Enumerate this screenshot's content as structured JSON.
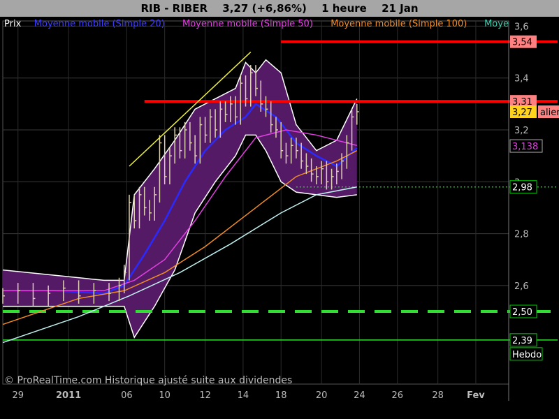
{
  "header": {
    "symbol": "RIB - RIBER",
    "price_change": "3,27 (+6,86%)",
    "timeframe": "1 heure",
    "date": "21 Jan"
  },
  "legend": [
    {
      "label": "Prix",
      "color": "#ffffff"
    },
    {
      "label": "Moyenne mobile (Simple 20)",
      "color": "#3c3cff"
    },
    {
      "label": "Moyenne mobile (Simple 50)",
      "color": "#e040e0"
    },
    {
      "label": "Moyenne mobile (Simple 100)",
      "color": "#f08c28"
    },
    {
      "label": "Moye",
      "color": "#40d0b0"
    }
  ],
  "footer": "© ProRealTime.com Historique ajusté suite aux dividendes",
  "price_tags": [
    {
      "text": "3,54",
      "value": 3.54,
      "bg": "#ff8080",
      "fg": "#000000"
    },
    {
      "text": "3,31",
      "value": 3.31,
      "bg": "#ff8080",
      "fg": "#000000"
    },
    {
      "text": "alier",
      "value": 3.27,
      "bg": "#ff8080",
      "fg": "#000000",
      "offset": "right"
    },
    {
      "text": "3,27",
      "value": 3.27,
      "bg": "#ffd21e",
      "fg": "#000000"
    },
    {
      "text": "3,138",
      "value": 3.138,
      "bg": "#000000",
      "fg": "#e040e0",
      "border": "#aaaaaa"
    },
    {
      "text": "2,98",
      "value": 2.98,
      "bg": "#000000",
      "fg": "#ffffff",
      "border": "#00cc00"
    },
    {
      "text": "2,50",
      "value": 2.5,
      "bg": "#000000",
      "fg": "#ffffff",
      "border": "#00cc00"
    },
    {
      "text": "2,39",
      "value": 2.39,
      "bg": "#000000",
      "fg": "#ffffff",
      "border": "#00cc00"
    },
    {
      "text": "Hebdo",
      "value": 2.36,
      "bg": "#000000",
      "fg": "#ffffff",
      "border": "#00cc00"
    }
  ],
  "chart_data": {
    "type": "line",
    "title": "RIB - RIBER 3,27 (+6,86%) 1 heure 21 Jan",
    "ylim": [
      2.22,
      3.62
    ],
    "y_ticks": [
      2.6,
      2.8,
      3.0,
      3.2,
      3.4,
      3.6
    ],
    "y_tick_labels": [
      "2,6",
      "2,8",
      "3",
      "3,2",
      "3,4",
      "3,6"
    ],
    "x_ticks": [
      "29",
      "2011",
      "06",
      "10",
      "12",
      "14",
      "18",
      "20",
      "24",
      "26",
      "28",
      "Fev"
    ],
    "x_tick_bold": [
      "2011",
      "Fev"
    ],
    "grid": true,
    "horizontal_lines": [
      {
        "value": 3.54,
        "color": "#ff0000",
        "style": "solid",
        "x_from": 0.55,
        "x_to": 1.0
      },
      {
        "value": 3.31,
        "color": "#ff0000",
        "style": "solid",
        "x_from": 0.28,
        "x_to": 1.0
      },
      {
        "value": 2.98,
        "color": "#30c030",
        "style": "dotted",
        "x_from": 0.58,
        "x_to": 1.0
      },
      {
        "value": 2.5,
        "color": "#30e030",
        "style": "dashed",
        "x_from": 0.0,
        "x_to": 1.0
      },
      {
        "value": 2.39,
        "color": "#30e030",
        "style": "solid",
        "x_from": 0.0,
        "x_to": 1.0
      }
    ],
    "trendline": {
      "color": "#f0f040",
      "points": [
        [
          0.25,
          3.06
        ],
        [
          0.49,
          3.5
        ]
      ]
    },
    "price_series": {
      "name": "Prix",
      "x": [
        0.0,
        0.03,
        0.06,
        0.09,
        0.12,
        0.15,
        0.18,
        0.21,
        0.23,
        0.24,
        0.25,
        0.26,
        0.27,
        0.28,
        0.29,
        0.3,
        0.31,
        0.32,
        0.33,
        0.34,
        0.35,
        0.36,
        0.37,
        0.38,
        0.39,
        0.4,
        0.41,
        0.42,
        0.43,
        0.44,
        0.45,
        0.46,
        0.47,
        0.48,
        0.49,
        0.5,
        0.51,
        0.52,
        0.53,
        0.54,
        0.55,
        0.56,
        0.57,
        0.58,
        0.59,
        0.6,
        0.61,
        0.62,
        0.63,
        0.64,
        0.65,
        0.66,
        0.67,
        0.68,
        0.69,
        0.7
      ],
      "values": [
        2.56,
        2.58,
        2.55,
        2.57,
        2.59,
        2.56,
        2.58,
        2.57,
        2.6,
        2.65,
        2.92,
        2.85,
        2.95,
        2.9,
        2.88,
        2.95,
        3.15,
        3.02,
        3.1,
        3.18,
        3.12,
        3.2,
        3.15,
        3.1,
        3.22,
        3.18,
        3.25,
        3.2,
        3.28,
        3.26,
        3.3,
        3.25,
        3.38,
        3.32,
        3.42,
        3.36,
        3.3,
        3.28,
        3.22,
        3.2,
        3.12,
        3.1,
        3.14,
        3.12,
        3.08,
        3.06,
        3.03,
        3.02,
        3.05,
        3.0,
        3.02,
        3.04,
        3.08,
        3.15,
        3.25,
        3.27
      ]
    },
    "series": [
      {
        "name": "Moyenne mobile (Simple 20)",
        "color": "#2a2aff",
        "x": [
          0.0,
          0.1,
          0.2,
          0.24,
          0.28,
          0.32,
          0.36,
          0.4,
          0.44,
          0.48,
          0.5,
          0.54,
          0.58,
          0.62,
          0.66,
          0.7
        ],
        "values": [
          2.58,
          2.58,
          2.57,
          2.6,
          2.72,
          2.85,
          3.0,
          3.12,
          3.2,
          3.25,
          3.3,
          3.25,
          3.15,
          3.1,
          3.06,
          3.13
        ]
      },
      {
        "name": "Moyenne mobile (Simple 50)",
        "color": "#e040e0",
        "x": [
          0.0,
          0.2,
          0.26,
          0.32,
          0.38,
          0.44,
          0.5,
          0.56,
          0.62,
          0.7
        ],
        "values": [
          2.58,
          2.58,
          2.62,
          2.7,
          2.85,
          3.02,
          3.17,
          3.2,
          3.18,
          3.14
        ]
      },
      {
        "name": "Moyenne mobile (Simple 100)",
        "color": "#f08c28",
        "x": [
          0.0,
          0.15,
          0.24,
          0.32,
          0.4,
          0.5,
          0.58,
          0.66,
          0.7
        ],
        "values": [
          2.45,
          2.55,
          2.58,
          2.65,
          2.75,
          2.9,
          3.02,
          3.08,
          3.12
        ]
      },
      {
        "name": "Moye",
        "color": "#c0f0f0",
        "x": [
          0.0,
          0.15,
          0.25,
          0.35,
          0.45,
          0.55,
          0.62,
          0.7
        ],
        "values": [
          2.38,
          2.48,
          2.56,
          2.65,
          2.76,
          2.88,
          2.95,
          2.98
        ]
      }
    ],
    "bollinger": {
      "x": [
        0.0,
        0.1,
        0.2,
        0.24,
        0.26,
        0.3,
        0.34,
        0.38,
        0.42,
        0.46,
        0.48,
        0.5,
        0.52,
        0.55,
        0.58,
        0.62,
        0.66,
        0.7
      ],
      "upper": [
        2.66,
        2.64,
        2.62,
        2.62,
        2.95,
        3.05,
        3.16,
        3.28,
        3.32,
        3.36,
        3.46,
        3.42,
        3.47,
        3.42,
        3.22,
        3.12,
        3.16,
        3.32
      ],
      "lower": [
        2.52,
        2.52,
        2.52,
        2.52,
        2.4,
        2.52,
        2.66,
        2.88,
        3.0,
        3.1,
        3.18,
        3.18,
        3.12,
        3.0,
        2.96,
        2.95,
        2.94,
        2.95
      ]
    }
  }
}
